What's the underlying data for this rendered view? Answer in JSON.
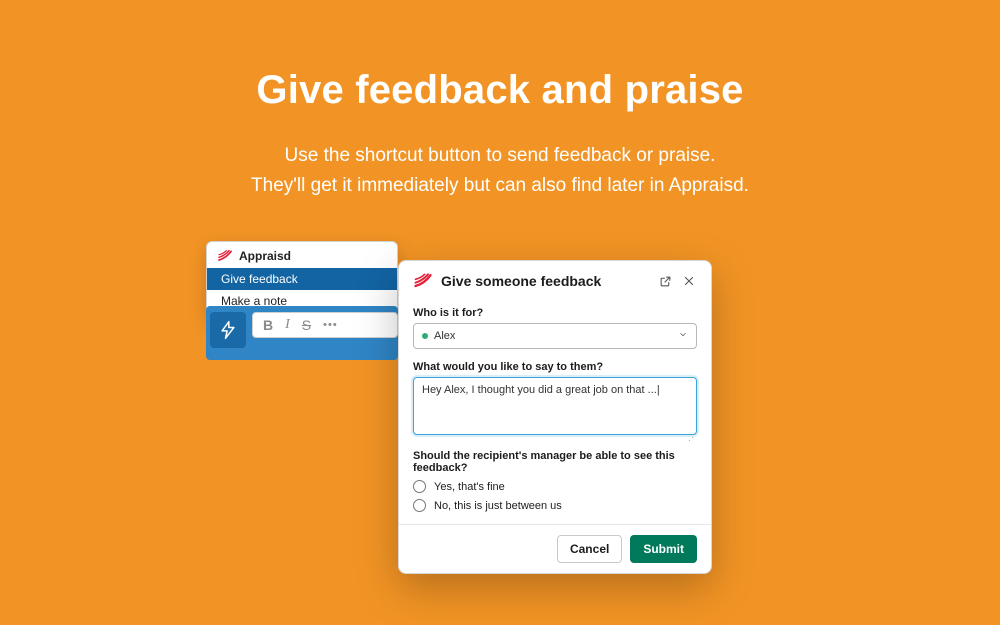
{
  "hero": {
    "title": "Give feedback and praise",
    "line1": "Use the shortcut button to send feedback or praise.",
    "line2": "They'll get it immediately but can also find later in Appraisd."
  },
  "shortcut": {
    "app_name": "Appraisd",
    "items": [
      {
        "label": "Give feedback",
        "selected": true
      },
      {
        "label": "Make a note",
        "selected": false
      }
    ]
  },
  "compose_toolbar": {
    "buttons": [
      "bold",
      "italic",
      "strike",
      "more"
    ]
  },
  "modal": {
    "title": "Give someone feedback",
    "fields": {
      "who": {
        "label": "Who is it for?",
        "value": "Alex",
        "status": "active"
      },
      "message": {
        "label": "What would you like to say to them?",
        "value": "Hey Alex, I thought you did a great job on that ...|"
      },
      "visibility": {
        "label": "Should the recipient's manager be able to see this feedback?",
        "options": [
          {
            "label": "Yes, that's fine",
            "checked": false
          },
          {
            "label": "No, this is just between us",
            "checked": false
          }
        ]
      }
    },
    "buttons": {
      "cancel": "Cancel",
      "submit": "Submit"
    }
  }
}
